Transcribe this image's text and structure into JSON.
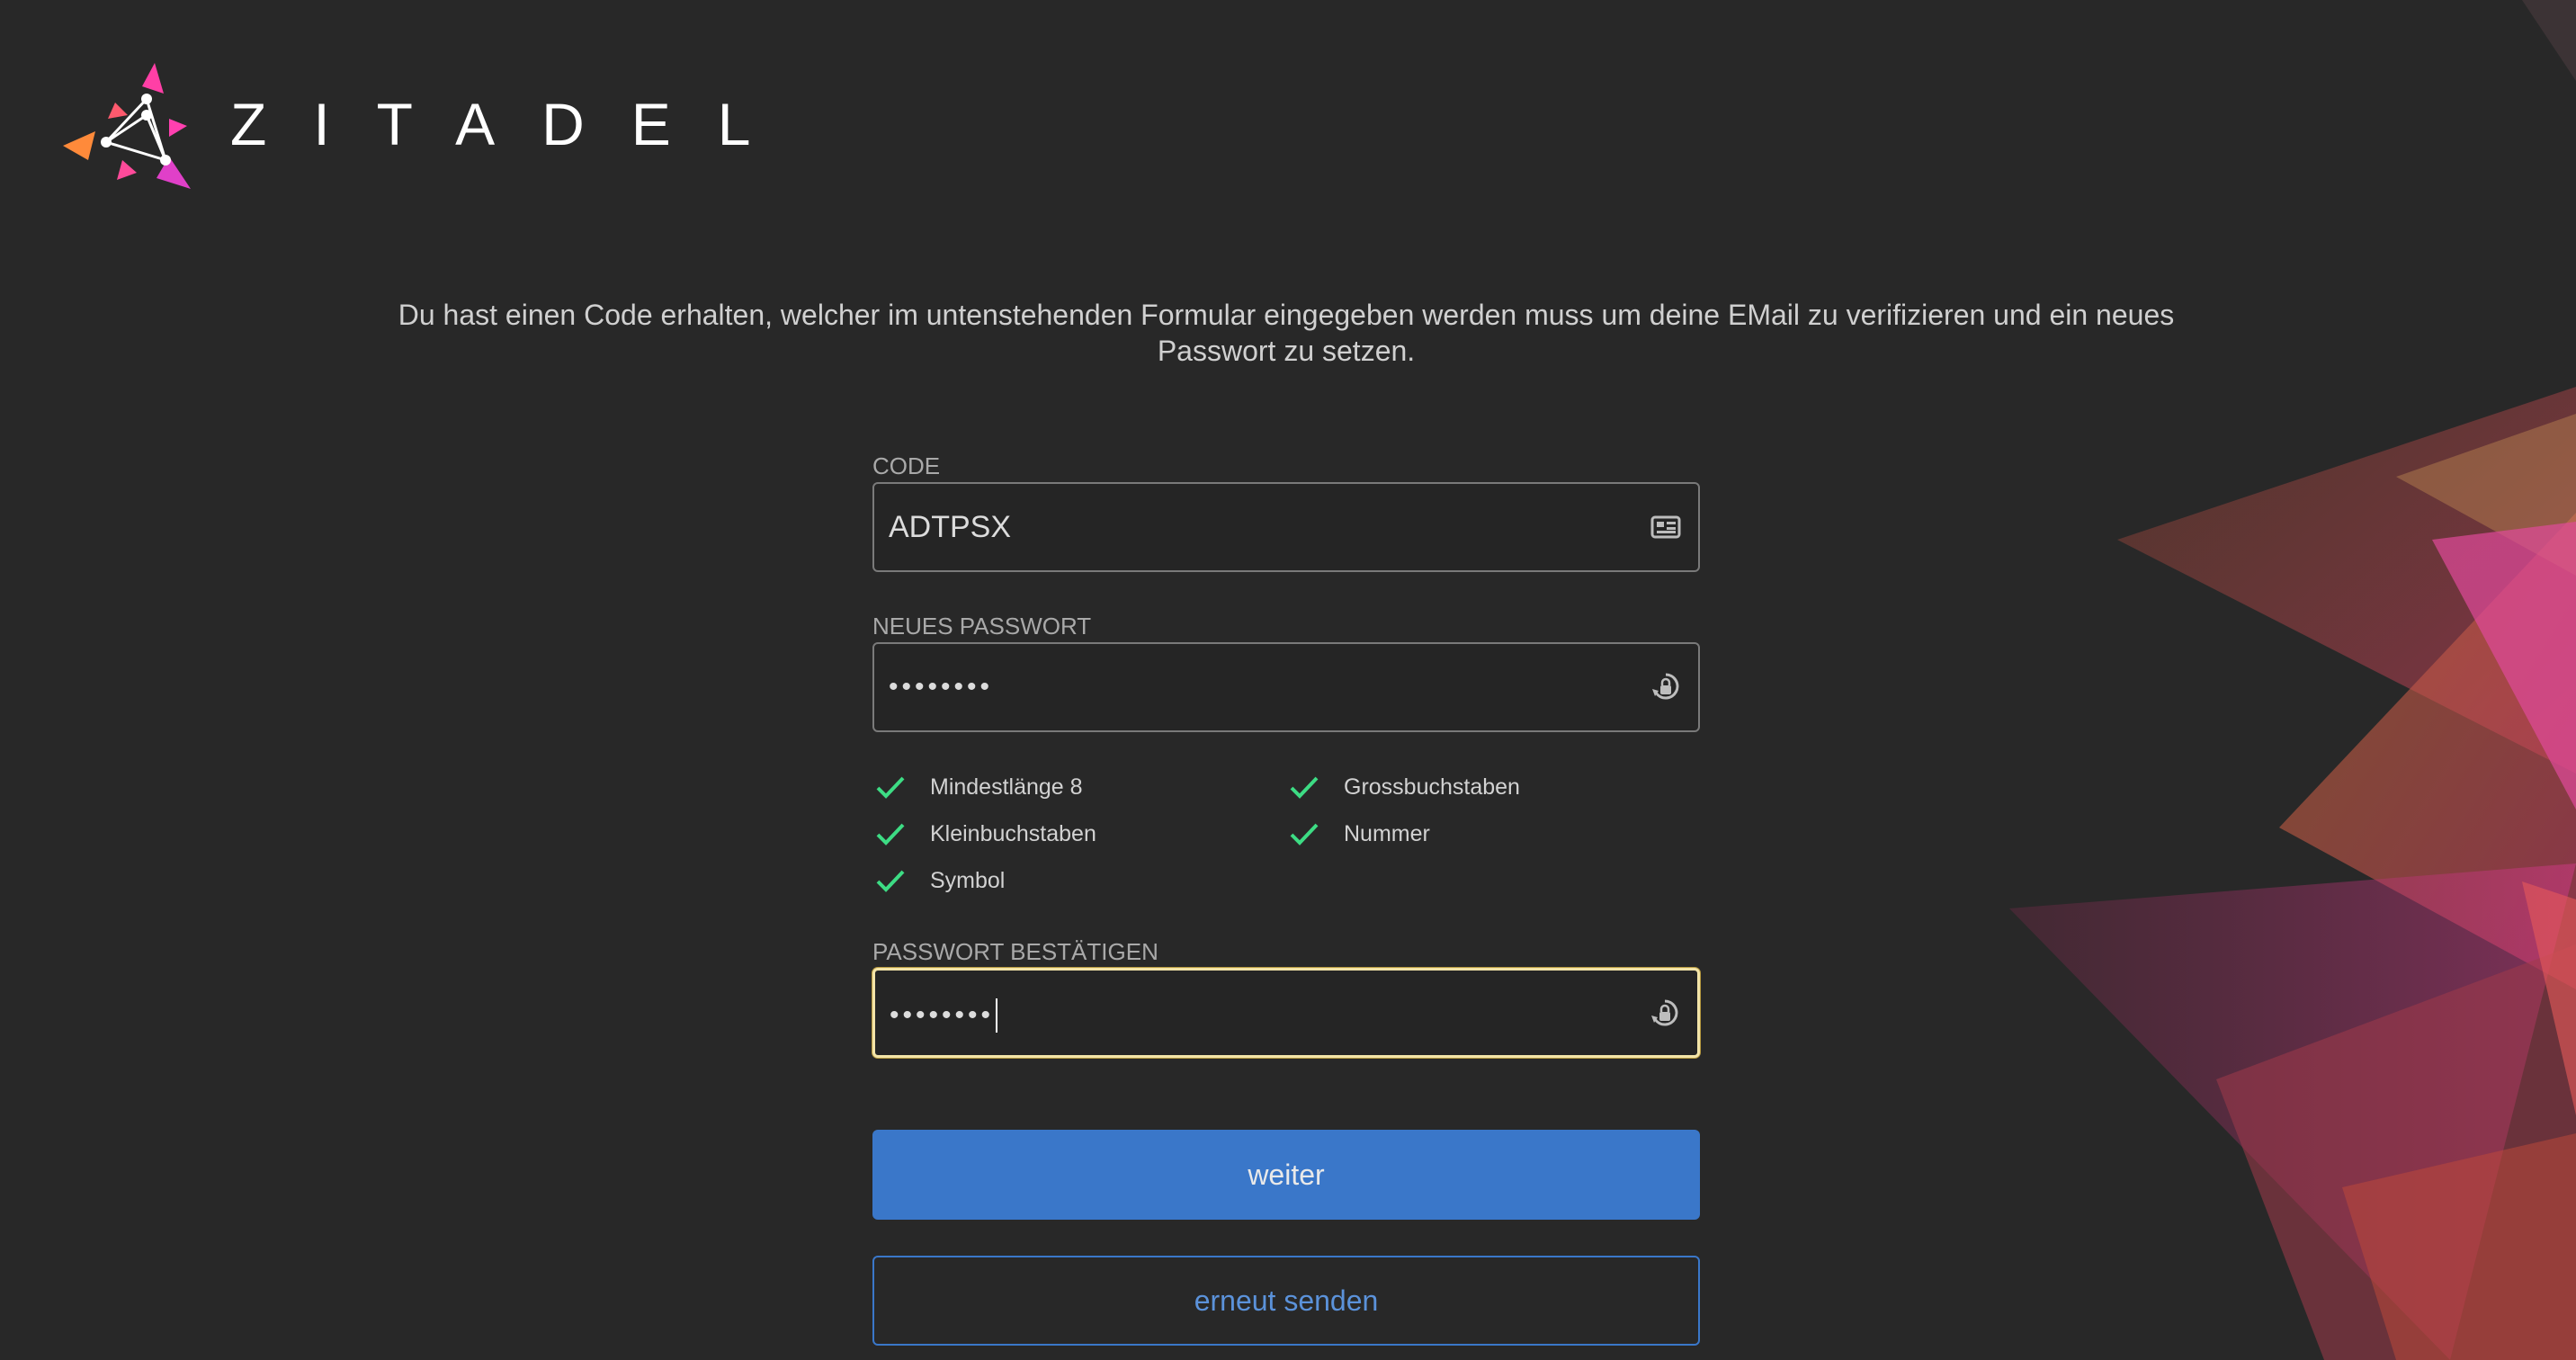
{
  "brand": {
    "name": "ZITADEL"
  },
  "intro_text": "Du hast einen Code erhalten, welcher im untenstehenden Formular eingegeben werden muss um deine EMail zu verifizieren und ein neues Passwort zu setzen.",
  "fields": {
    "code": {
      "label": "CODE",
      "value": "ADTPSX",
      "icon": "id-card-icon"
    },
    "new_password": {
      "label": "NEUES PASSWORT",
      "value": "••••••••",
      "icon": "lock-eye-icon"
    },
    "confirm_password": {
      "label": "PASSWORT BESTÄTIGEN",
      "value": "••••••••",
      "icon": "lock-eye-icon"
    }
  },
  "requirements": [
    {
      "label": "Mindestlänge 8",
      "met": true
    },
    {
      "label": "Grossbuchstaben",
      "met": true
    },
    {
      "label": "Kleinbuchstaben",
      "met": true
    },
    {
      "label": "Nummer",
      "met": true
    },
    {
      "label": "Symbol",
      "met": true
    }
  ],
  "buttons": {
    "next": "weiter",
    "resend": "erneut senden"
  },
  "colors": {
    "background": "#282828",
    "primary": "#3a77c9",
    "check": "#3ddc84",
    "focus": "#f3e4a8"
  }
}
